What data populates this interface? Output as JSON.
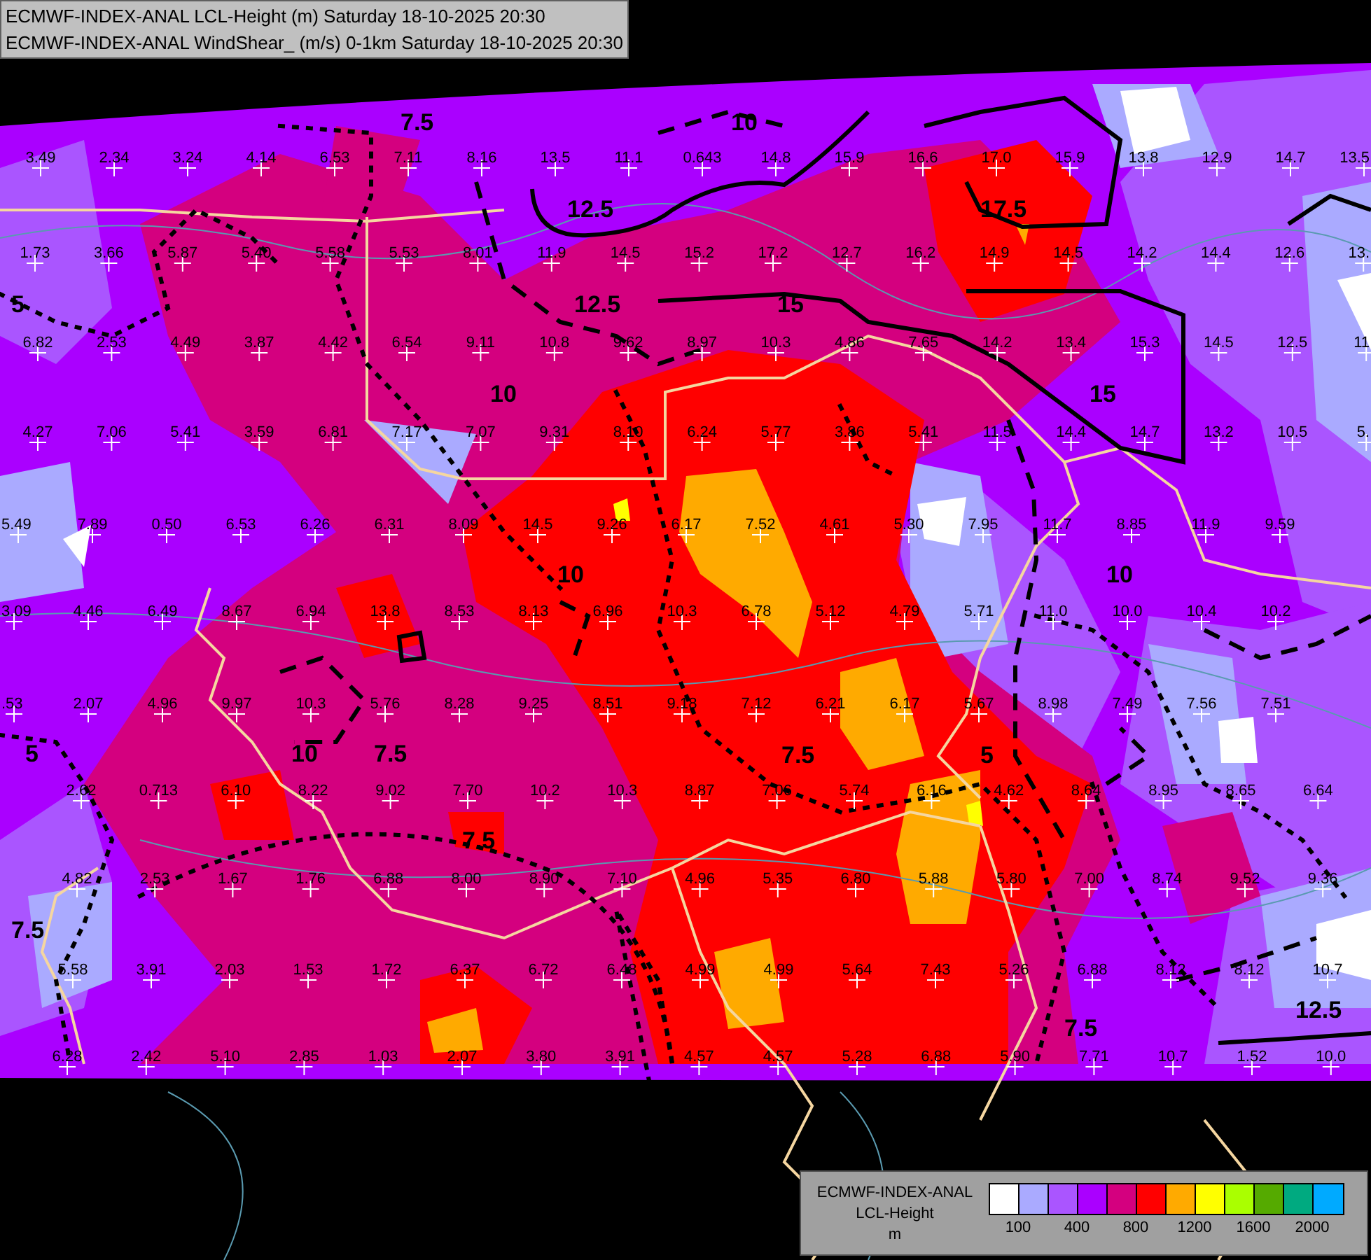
{
  "header": {
    "lines": [
      "ECMWF-INDEX-ANAL LCL-Height (m) Saturday 18-10-2025 20:30",
      "ECMWF-INDEX-ANAL WindShear_ (m/s) 0-1km Saturday 18-10-2025 20:30"
    ]
  },
  "station_rows": [
    [
      "3.49",
      "2.34",
      "3.24",
      "4.14",
      "6.53",
      "7.11",
      "8.16",
      "13.5",
      "11.1",
      "0.643",
      "14.8",
      "15.9",
      "16.6",
      "17.0",
      "15.9",
      "13.8",
      "12.9",
      "14.7",
      "13.5"
    ],
    [
      "1.73",
      "3.66",
      "5.87",
      "5.40",
      "5.58",
      "5.53",
      "8.01",
      "11.9",
      "14.5",
      "15.2",
      "17.2",
      "12.7",
      "16.2",
      "14.9",
      "14.5",
      "14.2",
      "14.4",
      "12.6",
      "13."
    ],
    [
      "6.82",
      "2.53",
      "4.49",
      "3.87",
      "4.42",
      "6.54",
      "9.11",
      "10.8",
      "9.62",
      "8.97",
      "10.3",
      "4.86",
      "7.65",
      "14.2",
      "13.4",
      "15.3",
      "14.5",
      "12.5",
      "11"
    ],
    [
      "4.27",
      "7.06",
      "5.41",
      "3.59",
      "6.81",
      "7.17",
      "7.07",
      "9.31",
      "8.10",
      "6.24",
      "5.77",
      "3.86",
      "5.41",
      "11.5",
      "14.4",
      "14.7",
      "13.2",
      "10.5",
      "5."
    ],
    [
      "5.49",
      "7.89",
      "0.50",
      "6.53",
      "6.26",
      "6.31",
      "8.09",
      "14.5",
      "9.26",
      "6.17",
      "7.52",
      "4.61",
      "5.30",
      "7.95",
      "11.7",
      "8.85",
      "11.9",
      "9.59"
    ],
    [
      "3.09",
      "4.46",
      "6.49",
      "8.67",
      "6.94",
      "13.8",
      "8.53",
      "8.13",
      "6.96",
      "10.3",
      "6.78",
      "5.12",
      "4.79",
      "5.71",
      "11.0",
      "10.0",
      "10.4",
      "10.2"
    ],
    [
      ".53",
      "2.07",
      "4.96",
      "9.97",
      "10.3",
      "5.76",
      "8.28",
      "9.25",
      "8.51",
      "9.18",
      "7.12",
      "6.21",
      "6.17",
      "5.67",
      "8.98",
      "7.49",
      "7.56",
      "7.51"
    ],
    [
      "2.62",
      "0.713",
      "6.10",
      "8.22",
      "9.02",
      "7.70",
      "10.2",
      "10.3",
      "8.87",
      "7.06",
      "5.74",
      "6.16",
      "4.62",
      "8.64",
      "8.95",
      "8.65",
      "6.64"
    ],
    [
      "4.82",
      "2.53",
      "1.67",
      "1.76",
      "6.88",
      "8.00",
      "8.90",
      "7.10",
      "4.96",
      "5.35",
      "6.80",
      "5.88",
      "5.80",
      "7.00",
      "8.74",
      "9.52",
      "9.36"
    ],
    [
      "5.58",
      "3.91",
      "2.03",
      "1.53",
      "1.72",
      "6.37",
      "6.72",
      "6.48",
      "4.99",
      "4.99",
      "5.64",
      "7.43",
      "5.26",
      "6.88",
      "8.12",
      "8.12",
      "10.7"
    ],
    [
      "6.28",
      "2.42",
      "5.10",
      "2.85",
      "1.03",
      "2.07",
      "3.80",
      "3.91",
      "4.57",
      "4.57",
      "5.28",
      "6.88",
      "5.90",
      "7.71",
      "10.7",
      "1.52",
      "10.0"
    ]
  ],
  "contour_labels": [
    "7.5",
    "12.5",
    "10",
    "12.5",
    "15",
    "17.5",
    "15",
    "5",
    "10",
    "10",
    "10",
    "7.5",
    "7.5",
    "5",
    "7.5",
    "10",
    "12.5",
    "7.5",
    "5",
    "7.5"
  ],
  "legend": {
    "title_lines": [
      "ECMWF-INDEX-ANAL",
      "LCL-Height",
      "m"
    ],
    "swatches": [
      {
        "color": "#ffffff"
      },
      {
        "color": "#aaaaff"
      },
      {
        "color": "#aa55ff"
      },
      {
        "color": "#aa00ff"
      },
      {
        "color": "#d4007f"
      },
      {
        "color": "#ff0000"
      },
      {
        "color": "#ffaa00"
      },
      {
        "color": "#ffff00"
      },
      {
        "color": "#aaff00"
      },
      {
        "color": "#55aa00"
      },
      {
        "color": "#00aa80"
      },
      {
        "color": "#00aaff"
      }
    ],
    "ticks": [
      "100",
      "400",
      "800",
      "1200",
      "1600",
      "2000"
    ]
  }
}
